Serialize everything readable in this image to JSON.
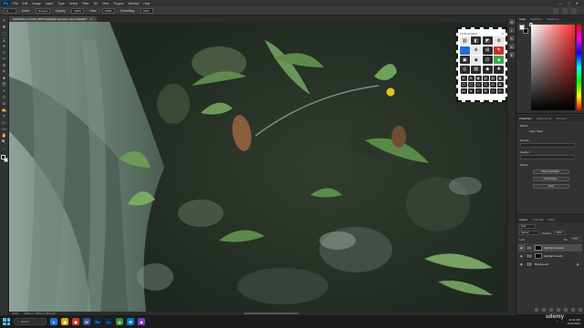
{
  "app": {
    "name": "Photoshop",
    "menu": [
      "File",
      "Edit",
      "Image",
      "Layer",
      "Type",
      "Select",
      "Filter",
      "3D",
      "View",
      "Plugins",
      "Window",
      "Help"
    ],
    "window_controls": [
      "—",
      "□",
      "✕"
    ]
  },
  "options_bar": {
    "items": [
      "Mode:",
      "Normal",
      "Opacity:",
      "100%",
      "Flow:",
      "100%",
      "Smoothing:",
      "10%"
    ]
  },
  "document": {
    "tab_title": "20201009-7-2-DSC_8875 (Highlight General, Layer Mask/8) *",
    "tab_close": "✕"
  },
  "toolbar": {
    "tools": [
      "↖",
      "✥",
      "⬚",
      "ʆ",
      "⌖",
      "⊹",
      "✂",
      "⊘",
      "✎",
      "♣",
      "⎘",
      "◐",
      "◇",
      "⊙",
      "✍",
      "T",
      "▷",
      "▭",
      "✋",
      "🔍",
      "…"
    ]
  },
  "brush_panel": {
    "title": "TK Brush Mixer",
    "close": "✕",
    "main_buttons": [
      "▥",
      "◧",
      "◩",
      "⚙",
      "👤",
      "⊕",
      "⊞",
      "✎",
      "▣",
      "◉",
      "⌬",
      "◈",
      "◎",
      "▤",
      "◆",
      "✚"
    ],
    "small_buttons": [
      "⊟",
      "⊞",
      "▦",
      "▧",
      "▨",
      "▩",
      "◰",
      "◱",
      "◲",
      "◳",
      "⊡",
      "⊠",
      "⋈",
      "⋇",
      "⌗",
      "⌘",
      "⎔",
      "⏣"
    ]
  },
  "color_panel": {
    "tabs": [
      "Color",
      "Swatches",
      "Gradients"
    ],
    "foreground": "#ffffff",
    "background": "#000000"
  },
  "properties_panel": {
    "tabs": [
      "Properties",
      "Adjustments",
      "Libraries"
    ],
    "type_label": "Masks",
    "mask_name": "Layer Mask",
    "density_label": "Density:",
    "feather_label": "Feather:",
    "refine_label": "Refine:",
    "buttons": [
      "Select and Mask...",
      "Color Range...",
      "Invert"
    ]
  },
  "layers_panel": {
    "tabs": [
      "Layers",
      "Channels",
      "Paths"
    ],
    "kind_label": "Kind",
    "blend_mode": "Normal",
    "opacity_label": "Opacity:",
    "opacity_value": "100%",
    "lock_label": "Lock:",
    "fill_label": "Fill:",
    "fill_value": "100%",
    "layers": [
      {
        "name": "Highlight General",
        "selected": true
      },
      {
        "name": "Highlight Clouds",
        "selected": false
      },
      {
        "name": "Background",
        "selected": false
      }
    ]
  },
  "status_bar": {
    "zoom": "100%",
    "info": "4256 px x 2832 px (300 ppi)"
  },
  "taskbar": {
    "search_placeholder": "Search",
    "apps": [
      {
        "label": "e",
        "color": "#1f78d1"
      },
      {
        "label": "◼",
        "color": "#e2a21b"
      },
      {
        "label": "◉",
        "color": "#cc3c2c"
      },
      {
        "label": "W",
        "color": "#2b579a"
      },
      {
        "label": "Ps",
        "color": "#0b2a4a"
      },
      {
        "label": "Lr",
        "color": "#0e2d4e"
      },
      {
        "label": "◎",
        "color": "#3a8f3a"
      },
      {
        "label": "✉",
        "color": "#0078d4"
      },
      {
        "label": "◆",
        "color": "#7a3fbf"
      }
    ],
    "time": "12:11 PM",
    "date": "10/11/2022"
  },
  "watermark": "udemy"
}
